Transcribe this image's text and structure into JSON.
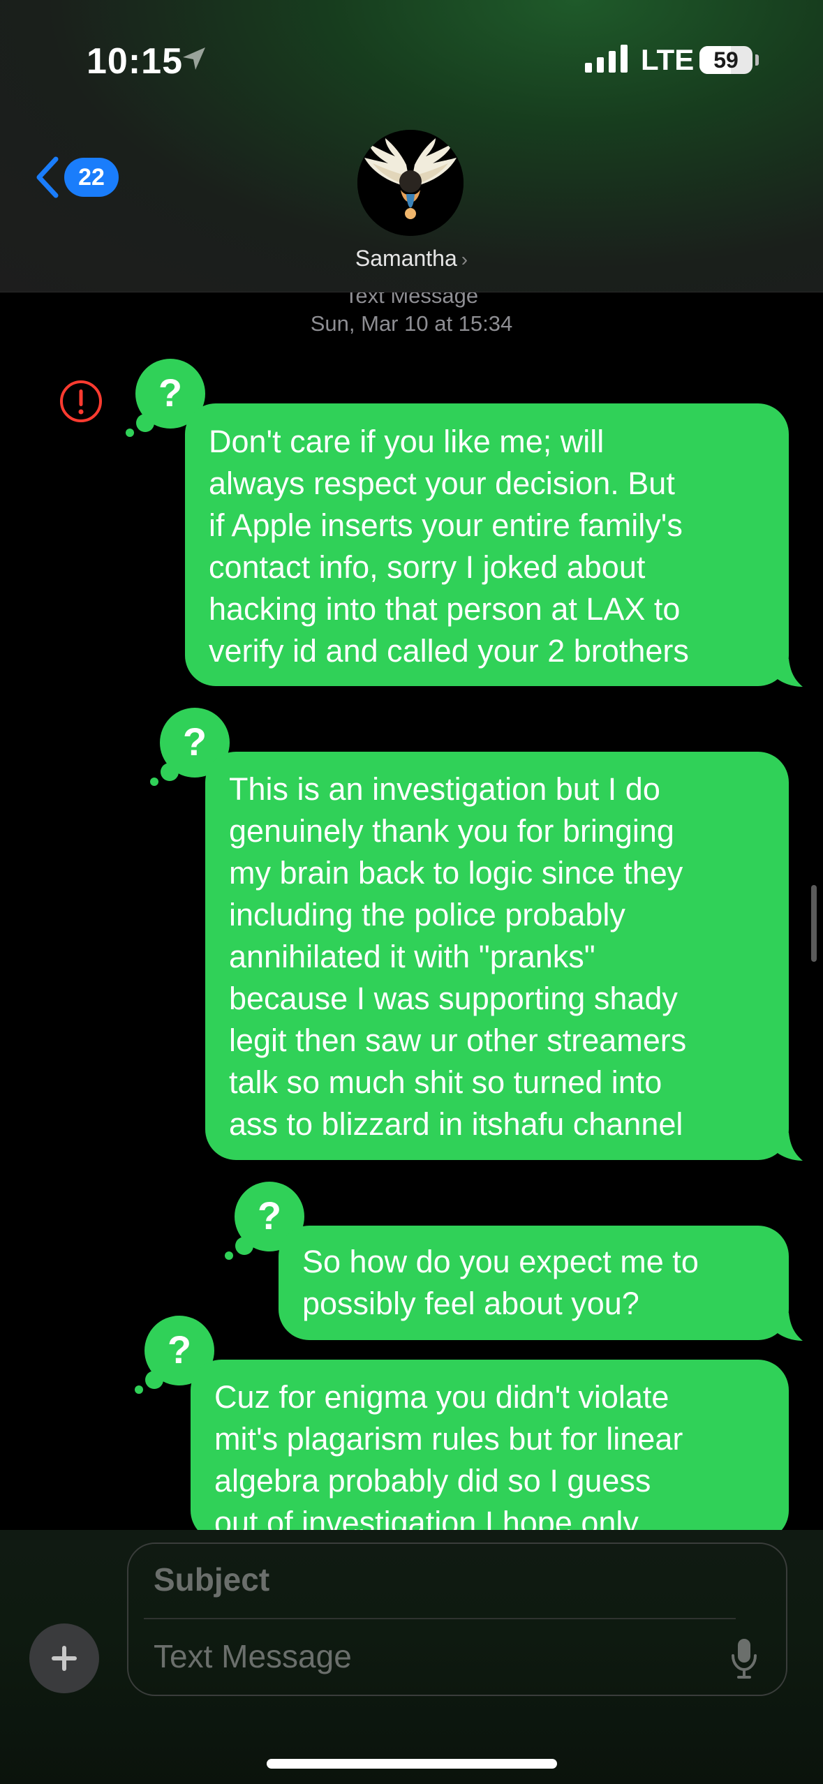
{
  "status_bar": {
    "time": "10:15",
    "network": "LTE",
    "battery": "59"
  },
  "header": {
    "unread_count": "22",
    "contact_name": "Samantha",
    "chevron": "›"
  },
  "thread": {
    "service_label": "Text Message",
    "date_label": "Sun, Mar 10 at 15:34",
    "messages": [
      {
        "text": "Don't care if you like me; will\nalways respect your decision. But\nif Apple inserts your entire family's\ncontact info, sorry I joked about\nhacking into that person at LAX to\nverify id and called your 2 brothers",
        "status_icon": "question-mark-icon"
      },
      {
        "text": "This is an investigation but I do\ngenuinely thank you for bringing\nmy brain back to logic since they\nincluding the police probably\nannihilated it with \"pranks\"\nbecause I was supporting shady\nlegit then saw ur other streamers\ntalk so much shit so turned into\nass to blizzard in itshafu channel",
        "status_icon": "question-mark-icon"
      },
      {
        "text": "So how do you expect me to\npossibly feel about you?",
        "status_icon": "question-mark-icon"
      },
      {
        "text": "Cuz for enigma you didn't violate\nmit's plagarism rules but for linear\nalgebra probably did so I guess\nout of investigation I hope only",
        "status_icon": "question-mark-icon"
      }
    ],
    "error_icon": "exclamation-circle-icon"
  },
  "compose": {
    "subject_placeholder": "Subject",
    "message_placeholder": "Text Message"
  },
  "colors": {
    "sms_bubble": "#30d158",
    "ios_blue": "#1a7dfb",
    "error_red": "#ff3b30"
  }
}
